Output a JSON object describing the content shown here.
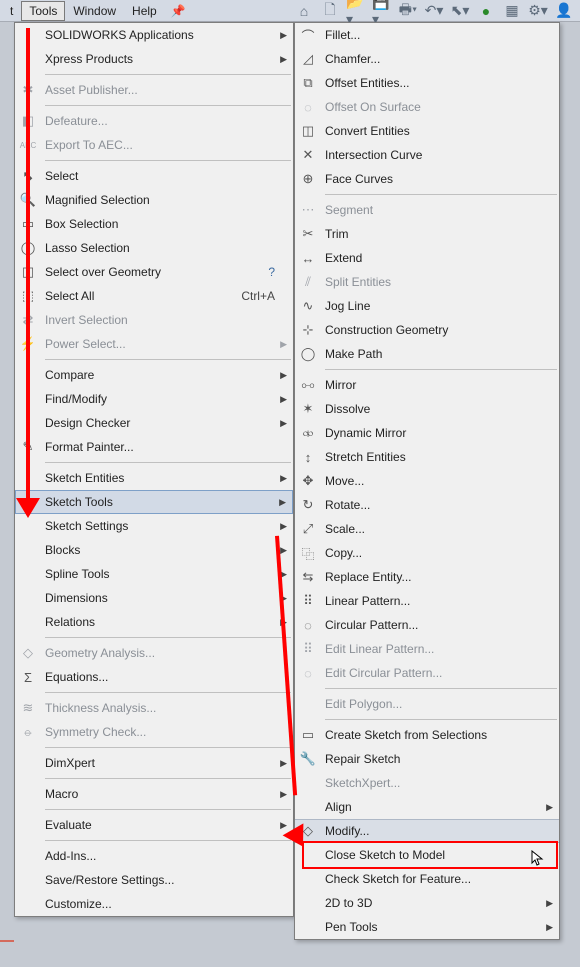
{
  "menubar": {
    "items": [
      "t",
      "Tools",
      "Window",
      "Help"
    ]
  },
  "tools_menu": {
    "groups": [
      [
        {
          "label": "SOLIDWORKS Applications",
          "fly": true,
          "enabled": true,
          "icon": ""
        },
        {
          "label": "Xpress Products",
          "fly": true,
          "enabled": true,
          "icon": ""
        }
      ],
      [
        {
          "label": "Asset Publisher...",
          "enabled": false,
          "icon": "asset"
        }
      ],
      [
        {
          "label": "Defeature...",
          "enabled": false,
          "icon": "defeature"
        },
        {
          "label": "Export To AEC...",
          "enabled": false,
          "icon": "aec"
        }
      ],
      [
        {
          "label": "Select",
          "enabled": true,
          "icon": "select"
        },
        {
          "label": "Magnified Selection",
          "enabled": true,
          "icon": "magnify"
        },
        {
          "label": "Box Selection",
          "enabled": true,
          "icon": "box"
        },
        {
          "label": "Lasso Selection",
          "enabled": true,
          "icon": "lasso"
        },
        {
          "label": "Select over Geometry",
          "enabled": true,
          "icon": "overgeom",
          "help": true
        },
        {
          "label": "Select All",
          "enabled": true,
          "icon": "selectall",
          "shortcut": "Ctrl+A"
        },
        {
          "label": "Invert Selection",
          "enabled": false,
          "icon": "invert"
        },
        {
          "label": "Power Select...",
          "enabled": false,
          "icon": "power",
          "fly": true
        }
      ],
      [
        {
          "label": "Compare",
          "enabled": true,
          "fly": true
        },
        {
          "label": "Find/Modify",
          "enabled": true,
          "fly": true
        },
        {
          "label": "Design Checker",
          "enabled": true,
          "fly": true
        },
        {
          "label": "Format Painter...",
          "enabled": true,
          "icon": "fpaint"
        }
      ],
      [
        {
          "label": "Sketch Entities",
          "enabled": true,
          "fly": true
        },
        {
          "label": "Sketch Tools",
          "enabled": true,
          "fly": true,
          "hover": true
        },
        {
          "label": "Sketch Settings",
          "enabled": true,
          "fly": true
        },
        {
          "label": "Blocks",
          "enabled": true,
          "fly": true
        },
        {
          "label": "Spline Tools",
          "enabled": true,
          "fly": true
        },
        {
          "label": "Dimensions",
          "enabled": true,
          "fly": true
        },
        {
          "label": "Relations",
          "enabled": true,
          "fly": true
        }
      ],
      [
        {
          "label": "Geometry Analysis...",
          "enabled": false,
          "icon": "geo"
        },
        {
          "label": "Equations...",
          "enabled": true,
          "icon": "sigma"
        }
      ],
      [
        {
          "label": "Thickness Analysis...",
          "enabled": false,
          "icon": "thick"
        },
        {
          "label": "Symmetry Check...",
          "enabled": false,
          "icon": "sym"
        }
      ],
      [
        {
          "label": "DimXpert",
          "enabled": true,
          "fly": true
        }
      ],
      [
        {
          "label": "Macro",
          "enabled": true,
          "fly": true
        }
      ],
      [
        {
          "label": "Evaluate",
          "enabled": true,
          "fly": true
        }
      ],
      [
        {
          "label": "Add-Ins...",
          "enabled": true
        },
        {
          "label": "Save/Restore Settings...",
          "enabled": true
        },
        {
          "label": "Customize...",
          "enabled": true
        }
      ]
    ]
  },
  "sketch_tools_menu": {
    "groups": [
      [
        {
          "label": "Fillet...",
          "enabled": true,
          "icon": "fillet"
        },
        {
          "label": "Chamfer...",
          "enabled": true,
          "icon": "chamfer"
        },
        {
          "label": "Offset Entities...",
          "enabled": true,
          "icon": "offset"
        },
        {
          "label": "Offset On Surface",
          "enabled": false,
          "icon": "offsurf"
        },
        {
          "label": "Convert Entities",
          "enabled": true,
          "icon": "convert"
        },
        {
          "label": "Intersection Curve",
          "enabled": true,
          "icon": "intersect"
        },
        {
          "label": "Face Curves",
          "enabled": true,
          "icon": "facecurves"
        }
      ],
      [
        {
          "label": "Segment",
          "enabled": false,
          "icon": "segment"
        },
        {
          "label": "Trim",
          "enabled": true,
          "icon": "trim"
        },
        {
          "label": "Extend",
          "enabled": true,
          "icon": "extend"
        },
        {
          "label": "Split Entities",
          "enabled": false,
          "icon": "split"
        },
        {
          "label": "Jog Line",
          "enabled": true,
          "icon": "jog"
        },
        {
          "label": "Construction Geometry",
          "enabled": true,
          "icon": "constr"
        },
        {
          "label": "Make Path",
          "enabled": true,
          "icon": "path"
        }
      ],
      [
        {
          "label": "Mirror",
          "enabled": true,
          "icon": "mirror"
        },
        {
          "label": "Dissolve",
          "enabled": true,
          "icon": "dissolve"
        },
        {
          "label": "Dynamic Mirror",
          "enabled": true,
          "icon": "dynmirror"
        },
        {
          "label": "Stretch Entities",
          "enabled": true,
          "icon": "stretch"
        },
        {
          "label": "Move...",
          "enabled": true,
          "icon": "move"
        },
        {
          "label": "Rotate...",
          "enabled": true,
          "icon": "rotate"
        },
        {
          "label": "Scale...",
          "enabled": true,
          "icon": "scale"
        },
        {
          "label": "Copy...",
          "enabled": true,
          "icon": "copy"
        },
        {
          "label": "Replace Entity...",
          "enabled": true,
          "icon": "replace"
        },
        {
          "label": "Linear Pattern...",
          "enabled": true,
          "icon": "linpat"
        },
        {
          "label": "Circular Pattern...",
          "enabled": true,
          "icon": "cirpat"
        },
        {
          "label": "Edit Linear Pattern...",
          "enabled": false,
          "icon": "edlin"
        },
        {
          "label": "Edit Circular Pattern...",
          "enabled": false,
          "icon": "edcir"
        }
      ],
      [
        {
          "label": "Edit Polygon...",
          "enabled": false
        }
      ],
      [
        {
          "label": "Create Sketch from Selections",
          "enabled": true,
          "icon": "createsel"
        },
        {
          "label": "Repair Sketch",
          "enabled": true,
          "icon": "repair"
        },
        {
          "label": "SketchXpert...",
          "enabled": false
        },
        {
          "label": "Align",
          "enabled": true,
          "fly": true
        },
        {
          "label": "Modify...",
          "enabled": true,
          "icon": "modify",
          "hover": true
        },
        {
          "label": "Close Sketch to Model",
          "enabled": true
        },
        {
          "label": "Check Sketch for Feature...",
          "enabled": true
        },
        {
          "label": "2D to 3D",
          "enabled": true,
          "fly": true
        },
        {
          "label": "Pen Tools",
          "enabled": true,
          "fly": true
        }
      ]
    ]
  }
}
